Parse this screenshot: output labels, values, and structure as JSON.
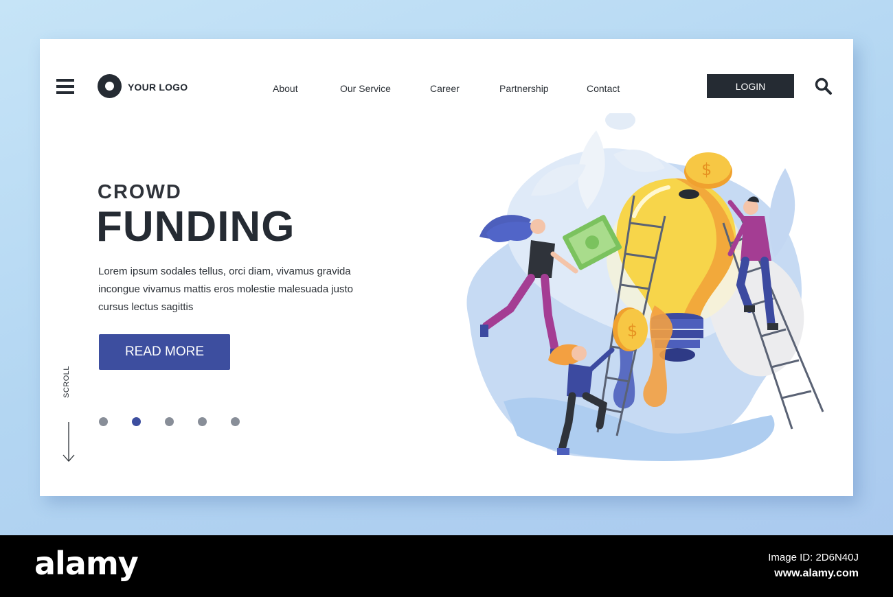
{
  "header": {
    "logo_text": "YOUR LOGO",
    "nav": [
      "About",
      "Our Service",
      "Career",
      "Partnership",
      "Contact"
    ],
    "login_label": "LOGIN"
  },
  "hero": {
    "kicker": "CROWD",
    "headline": "FUNDING",
    "body": "Lorem ipsum sodales tellus, orci diam, vivamus gravida incongue vivamus mattis eros molestie malesuada justo cursus lectus sagittis",
    "cta_label": "READ MORE",
    "scroll_label": "SCROLL",
    "slides_total": 5,
    "slide_active": 2
  },
  "footer": {
    "brand": "alamy",
    "image_id": "Image ID: 2D6N40J",
    "url": "www.alamy.com"
  },
  "colors": {
    "accent": "#3d4e9f",
    "dark": "#252b33",
    "background": "#b3d6f2"
  },
  "icons": [
    "menu-icon",
    "logo-mark-icon",
    "search-icon",
    "scroll-down-arrow-icon"
  ]
}
